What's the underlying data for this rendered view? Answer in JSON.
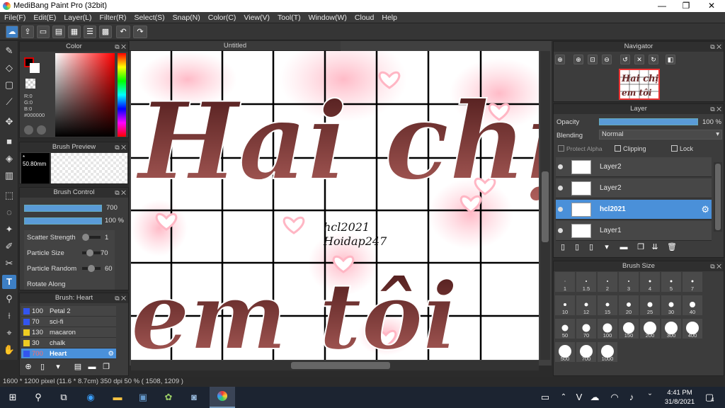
{
  "window": {
    "title": "MediBang Paint Pro (32bit)",
    "controls": [
      "—",
      "❐",
      "✕"
    ]
  },
  "menu": [
    "File(F)",
    "Edit(E)",
    "Layer(L)",
    "Filter(R)",
    "Select(S)",
    "Snap(N)",
    "Color(C)",
    "View(V)",
    "Tool(T)",
    "Window(W)",
    "Cloud",
    "Help"
  ],
  "document": {
    "tab_title": "Untitled",
    "canvas_text": {
      "line1": "Hai chị",
      "line2": "em tôi",
      "credit1": "hcl2021",
      "credit2": "Hoidap247"
    }
  },
  "panels": {
    "color": {
      "title": "Color",
      "r": "R:0",
      "g": "G:0",
      "b": "B:0",
      "hex": "#000000"
    },
    "brush_preview": {
      "title": "Brush Preview",
      "size": "* 50.80mm"
    },
    "brush_control": {
      "title": "Brush Control",
      "size_value": "700",
      "opacity_value": "100 %",
      "params": [
        {
          "label": "Scatter Strength",
          "value": "1"
        },
        {
          "label": "Particle Size",
          "value": "70"
        },
        {
          "label": "Particle Random",
          "value": "60"
        }
      ],
      "rotate_label": "Rotate Along"
    },
    "brush_list": {
      "title": "Brush: Heart",
      "items": [
        {
          "size": "100",
          "name": "Petal 2",
          "color": "#3355ee"
        },
        {
          "size": "70",
          "name": "sci-fi",
          "color": "#3355ee"
        },
        {
          "size": "130",
          "name": "macaron",
          "color": "#eecc22"
        },
        {
          "size": "30",
          "name": "chalk",
          "color": "#eecc22"
        },
        {
          "size": "700",
          "name": "Heart",
          "color": "#3355ee"
        }
      ]
    },
    "navigator": {
      "title": "Navigator"
    },
    "layer": {
      "title": "Layer",
      "opacity_label": "Opacity",
      "opacity_value": "100 %",
      "blending_label": "Blending",
      "blending_value": "Normal",
      "protect_alpha": "Protect Alpha",
      "clipping": "Clipping",
      "lock": "Lock",
      "layers": [
        "Layer2",
        "Layer2",
        "hcl2021",
        "Layer1"
      ]
    },
    "brush_size": {
      "title": "Brush Size",
      "sizes": [
        "1",
        "1.5",
        "2",
        "3",
        "4",
        "5",
        "7",
        "10",
        "12",
        "15",
        "20",
        "25",
        "30",
        "40",
        "50",
        "70",
        "100",
        "150",
        "200",
        "300",
        "400",
        "500",
        "700",
        "1000"
      ]
    }
  },
  "status": {
    "text": "1600 * 1200 pixel   (11.6 * 8.7cm)   350 dpi   50 %   ( 1508, 1209 )"
  },
  "taskbar": {
    "time": "4:41 PM",
    "date": "31/8/2021",
    "notifications": "4"
  }
}
